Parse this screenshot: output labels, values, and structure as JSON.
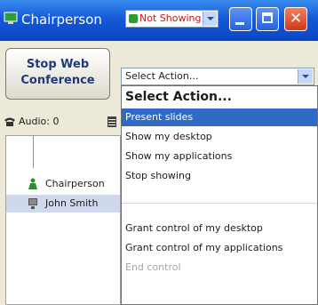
{
  "window": {
    "title": "Chairperson",
    "status_dropdown": {
      "value": "Not Showing"
    },
    "controls": {
      "minimize": "",
      "maximize": "",
      "close": "✕"
    }
  },
  "toolbar": {
    "stop_button_line1": "Stop Web",
    "stop_button_line2": "Conference",
    "action_dropdown": {
      "value": "Select Action..."
    }
  },
  "audio": {
    "label": "Audio: 0"
  },
  "participants": [
    {
      "name": "Chairperson",
      "icon": "person-icon",
      "selected": false
    },
    {
      "name": "John Smith",
      "icon": "computer-icon",
      "selected": true
    }
  ],
  "action_menu": {
    "header": "Select Action...",
    "items": [
      {
        "label": "Present slides",
        "highlighted": true,
        "disabled": false
      },
      {
        "label": "Show my desktop",
        "highlighted": false,
        "disabled": false
      },
      {
        "label": "Show my applications",
        "highlighted": false,
        "disabled": false
      },
      {
        "label": "Stop showing",
        "highlighted": false,
        "disabled": false
      }
    ],
    "control_items": [
      {
        "label": "Grant control of my desktop",
        "disabled": false
      },
      {
        "label": "Grant control of my applications",
        "disabled": false
      },
      {
        "label": "End control",
        "disabled": true
      }
    ]
  },
  "colors": {
    "titlebar": "#0a46c4",
    "highlight": "#316ac5",
    "status_text": "#d01010",
    "disabled_text": "#a4a4a4"
  }
}
